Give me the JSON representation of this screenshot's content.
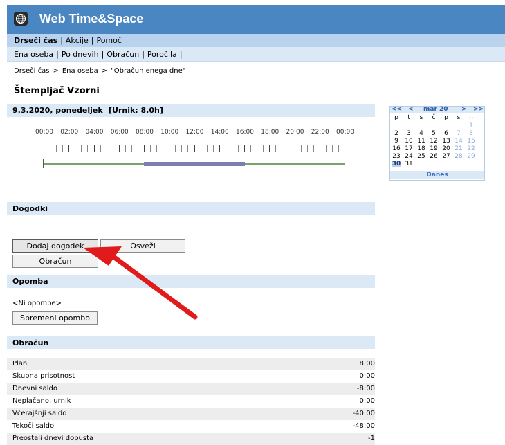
{
  "app": {
    "title": "Web Time&Space"
  },
  "nav1": [
    {
      "label": "Drseči čas",
      "active": true
    },
    {
      "label": "Akcije",
      "active": false
    },
    {
      "label": "Pomoč",
      "active": false
    }
  ],
  "nav2": [
    {
      "label": "Ena oseba"
    },
    {
      "label": "Po dnevih"
    },
    {
      "label": "Obračun"
    },
    {
      "label": "Poročila"
    }
  ],
  "breadcrumb": [
    "Drseči čas",
    "Ena oseba",
    "\"Obračun enega dne\""
  ],
  "person": "Štempljač Vzorni",
  "day": {
    "date": "9.3.2020, ponedeljek",
    "schedule": "[Urnik: 8.0h]"
  },
  "timeline": {
    "hours": [
      "00:00",
      "02:00",
      "04:00",
      "06:00",
      "08:00",
      "10:00",
      "12:00",
      "14:00",
      "16:00",
      "18:00",
      "20:00",
      "22:00",
      "00:00"
    ]
  },
  "sections": {
    "events": "Dogodki",
    "note": "Opomba",
    "calc": "Obračun"
  },
  "buttons": {
    "add_event": "Dodaj dogodek",
    "refresh": "Osveži",
    "calculation": "Obračun",
    "change_note": "Spremeni opombo"
  },
  "note_text": "<Ni opombe>",
  "calc_rows": [
    {
      "label": "Plan",
      "value": "8:00"
    },
    {
      "label": "Skupna prisotnost",
      "value": "0:00"
    },
    {
      "label": "Dnevni saldo",
      "value": "-8:00"
    },
    {
      "label": "Neplačano, urnik",
      "value": "0:00"
    },
    {
      "label": "Včerajšnji saldo",
      "value": "-40:00"
    },
    {
      "label": "Tekoči saldo",
      "value": "-48:00"
    },
    {
      "label": "Preostali dnevi dopusta",
      "value": "-1"
    }
  ],
  "calendar": {
    "prev_year": "<<",
    "prev_month": "<",
    "month": "mar 20",
    "next_month": ">",
    "next_year": ">>",
    "weekdays": [
      "p",
      "t",
      "s",
      "č",
      "p",
      "s",
      "n"
    ],
    "weeks": [
      [
        "",
        "",
        "",
        "",
        "",
        "",
        "1"
      ],
      [
        "2",
        "3",
        "4",
        "5",
        "6",
        "7",
        "8"
      ],
      [
        "9",
        "10",
        "11",
        "12",
        "13",
        "14",
        "15"
      ],
      [
        "16",
        "17",
        "18",
        "19",
        "20",
        "21",
        "22"
      ],
      [
        "23",
        "24",
        "25",
        "26",
        "27",
        "28",
        "29"
      ],
      [
        "30",
        "31",
        "",
        "",
        "",
        "",
        ""
      ]
    ],
    "today": "30",
    "today_label": "Danes"
  },
  "colors": {
    "header": "#4a86c2",
    "nav1": "#b9d3ee",
    "nav2": "#dbe8f6",
    "presence_band": "#7a7faf",
    "timeline_line": "#7aa26d",
    "arrow": "#e11b1b"
  }
}
